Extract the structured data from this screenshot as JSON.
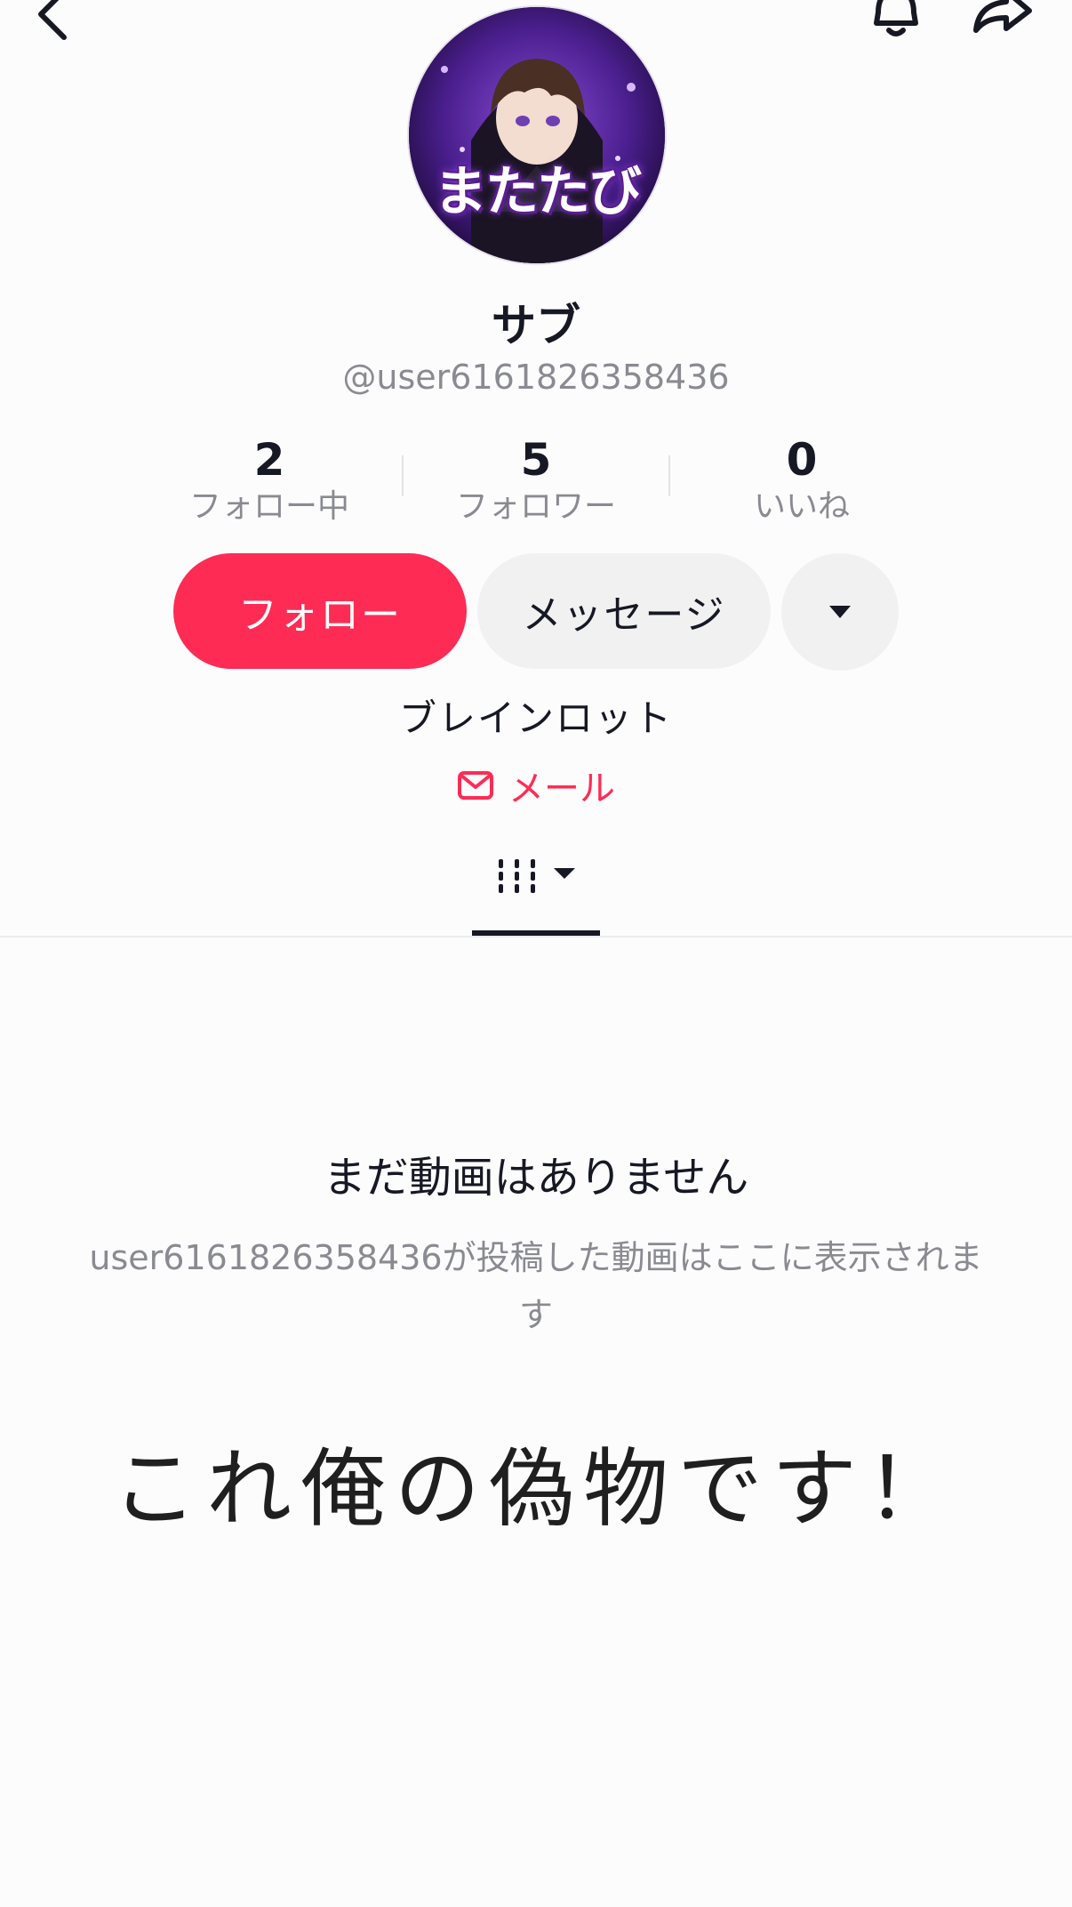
{
  "header": {
    "back_icon": "chevron-left-icon",
    "bell_icon": "bell-icon",
    "share_icon": "share-arrow-icon"
  },
  "profile": {
    "avatar_text": "またたび",
    "display_name": "サブ",
    "username": "@user6161826358436"
  },
  "stats": {
    "following": {
      "count": "2",
      "label": "フォロー中"
    },
    "followers": {
      "count": "5",
      "label": "フォロワー"
    },
    "likes": {
      "count": "0",
      "label": "いいね"
    }
  },
  "actions": {
    "follow_label": "フォロー",
    "message_label": "メッセージ",
    "more_icon": "caret-down-icon"
  },
  "bio": "ブレインロット",
  "email": {
    "icon": "mail-icon",
    "label": "メール"
  },
  "tabs": {
    "videos_icon": "grid-videos-icon"
  },
  "empty_state": {
    "title": "まだ動画はありません",
    "description": "user6161826358436が投稿した動画はここに表示されます"
  },
  "overlay_caption": "これ俺の偽物です！",
  "colors": {
    "accent": "#fe2c55",
    "text": "#161823",
    "muted": "#8a8b91",
    "button_bg": "#f1f1f2"
  }
}
